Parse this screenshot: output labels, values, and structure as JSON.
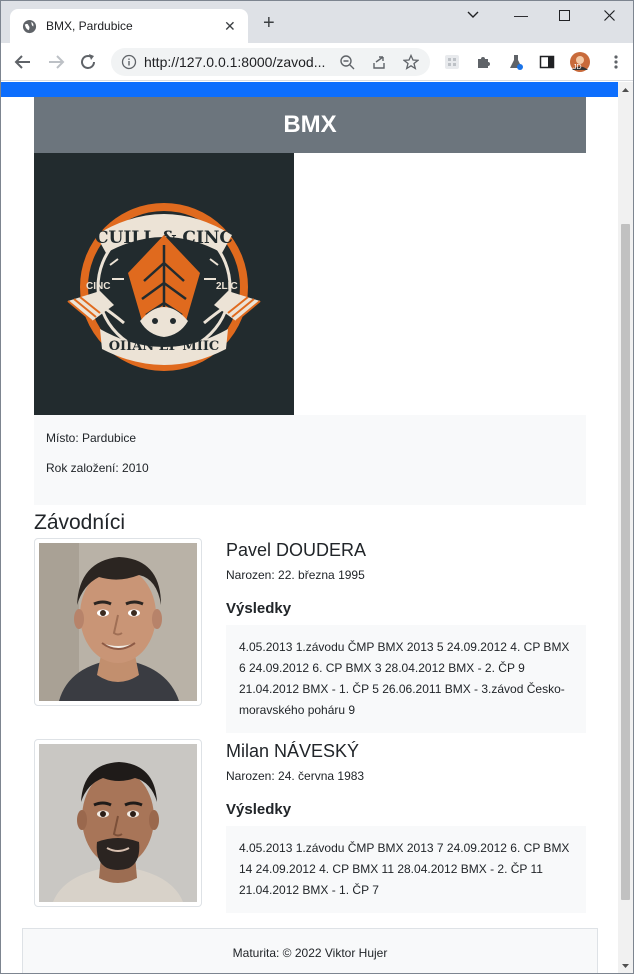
{
  "browser": {
    "tab_title": "BMX, Pardubice",
    "url": "http://127.0.0.1:8000/zavod...",
    "newtab_label": "+",
    "tab_close_label": "✕",
    "minimize_label": "—",
    "maximize_label": "☐",
    "close_label": "✕"
  },
  "navbar": {
    "partial_text": "' '"
  },
  "team": {
    "name": "BMX",
    "logo": {
      "top_text": "CUILL & CINC",
      "left_text": "CINC",
      "right_text": "2LIC",
      "bottom_text": "OIIAN EF MIIC"
    },
    "place": "Místo: Pardubice",
    "founded": "Rok založení: 2010"
  },
  "section_title": "Závodníci",
  "riders": [
    {
      "name": "Pavel DOUDERA",
      "born": "Narozen: 22. března 1995",
      "results_title": "Výsledky",
      "results": "4.05.2013 1.závodu ČMP BMX 2013 5 24.09.2012 4. CP BMX 6 24.09.2012 6. CP BMX 3 28.04.2012 BMX - 2. ČP 9 21.04.2012 BMX - 1. ČP 5 26.06.2011 BMX - 3.závod Česko-moravského poháru 9"
    },
    {
      "name": "Milan NÁVESKÝ",
      "born": "Narozen: 24. června 1983",
      "results_title": "Výsledky",
      "results": "4.05.2013 1.závodu ČMP BMX 2013 7 24.09.2012 6. CP BMX 14 24.09.2012 4. CP BMX 11 28.04.2012 BMX - 2. ČP 11 21.04.2012 BMX - 1. ČP 7"
    }
  ],
  "footer": "Maturita: © 2022 Viktor Hujer",
  "colors": {
    "navbar": "#0d6efd",
    "header": "#6c757d",
    "logo_bg": "#222b2e",
    "logo_accent": "#e06a1e"
  }
}
